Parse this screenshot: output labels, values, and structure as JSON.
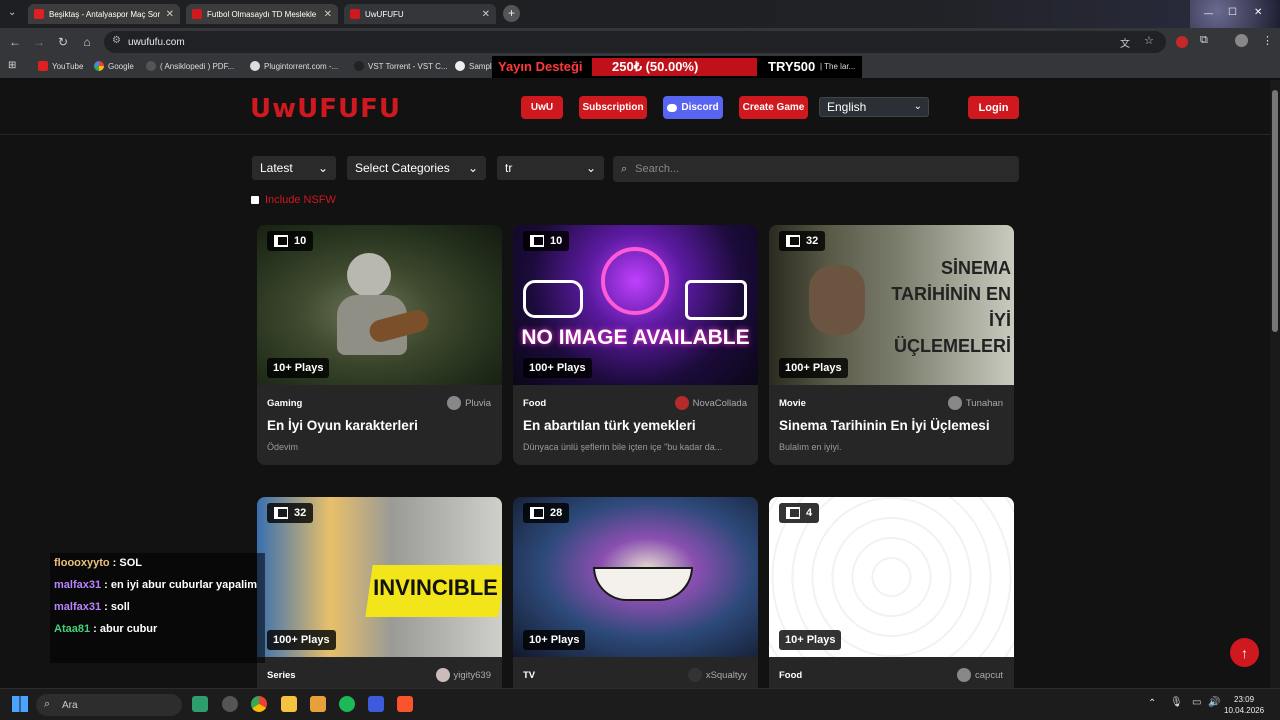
{
  "browser": {
    "tabs": [
      {
        "title": "Beşiktaş - Antalyaspor Maç Sor",
        "color": "#e02020"
      },
      {
        "title": "Futbol Olmasaydı TD Meslekle",
        "color": "#d0181f"
      },
      {
        "title": "UwUFUFU",
        "color": "#d0181f"
      }
    ],
    "url": "uwufufu.com",
    "bookmarks": [
      "YouTube",
      "Google",
      "( Ansiklopedi ) PDF...",
      "Plugintorrent.com -...",
      "VST Torrent - VST C...",
      "Sampl"
    ]
  },
  "stream_overlay": {
    "label": "Yayın Desteği",
    "progress_text": "250₺ (50.00%)",
    "progress": 0.5,
    "goal": "TRY500",
    "ticker": "| The lar..."
  },
  "header": {
    "logo": "UwUFUFU",
    "buttons": {
      "uwu": "UwU",
      "subscription": "Subscription",
      "discord": "Discord",
      "create": "Create Game",
      "login": "Login"
    },
    "language": "English"
  },
  "filters": {
    "sort": "Latest",
    "categories": "Select Categories",
    "locale": "tr",
    "search_placeholder": "Search...",
    "nsfw_label": "Include NSFW"
  },
  "cards": [
    {
      "count": "10",
      "plays": "10+ Plays",
      "category": "Gaming",
      "author": "Pluvia",
      "title": "En İyi Oyun karakterleri",
      "desc": "Ödevim"
    },
    {
      "count": "10",
      "plays": "100+ Plays",
      "category": "Food",
      "author": "NovaCollada",
      "title": "En abartılan türk yemekleri",
      "desc": "Dünyaca ünlü şeflerin bile içten içe \"bu kadar da...",
      "thumb_text": "NO IMAGE AVAILABLE"
    },
    {
      "count": "32",
      "plays": "100+ Plays",
      "category": "Movie",
      "author": "Tunahan",
      "title": "Sinema Tarihinin En İyi Üçlemesi",
      "desc": "Bulalım en iyiyi.",
      "thumb_text": "SİNEMA TARİHİNİN EN İYİ ÜÇLEMELERİ"
    },
    {
      "count": "32",
      "plays": "100+ Plays",
      "category": "Series",
      "author": "yigity639",
      "thumb_text": "INVINCIBLE"
    },
    {
      "count": "28",
      "plays": "10+ Plays",
      "category": "TV",
      "author": "xSqualtyy"
    },
    {
      "count": "4",
      "plays": "10+ Plays",
      "category": "Food",
      "author": "capcut"
    }
  ],
  "chat": [
    {
      "user": "floooxyyto",
      "text": " : SOL",
      "color": "#e8c27a"
    },
    {
      "user": "malfax31",
      "text": " : en iyi abur cuburlar yapalim",
      "color": "#b983ff"
    },
    {
      "user": "malfax31",
      "text": " : soll",
      "color": "#b983ff"
    },
    {
      "user": "Ataa81",
      "text": " : abur cubur",
      "color": "#45d07a"
    }
  ],
  "taskbar": {
    "search": "Ara",
    "time": "23:09",
    "date": "10.04.2026"
  }
}
